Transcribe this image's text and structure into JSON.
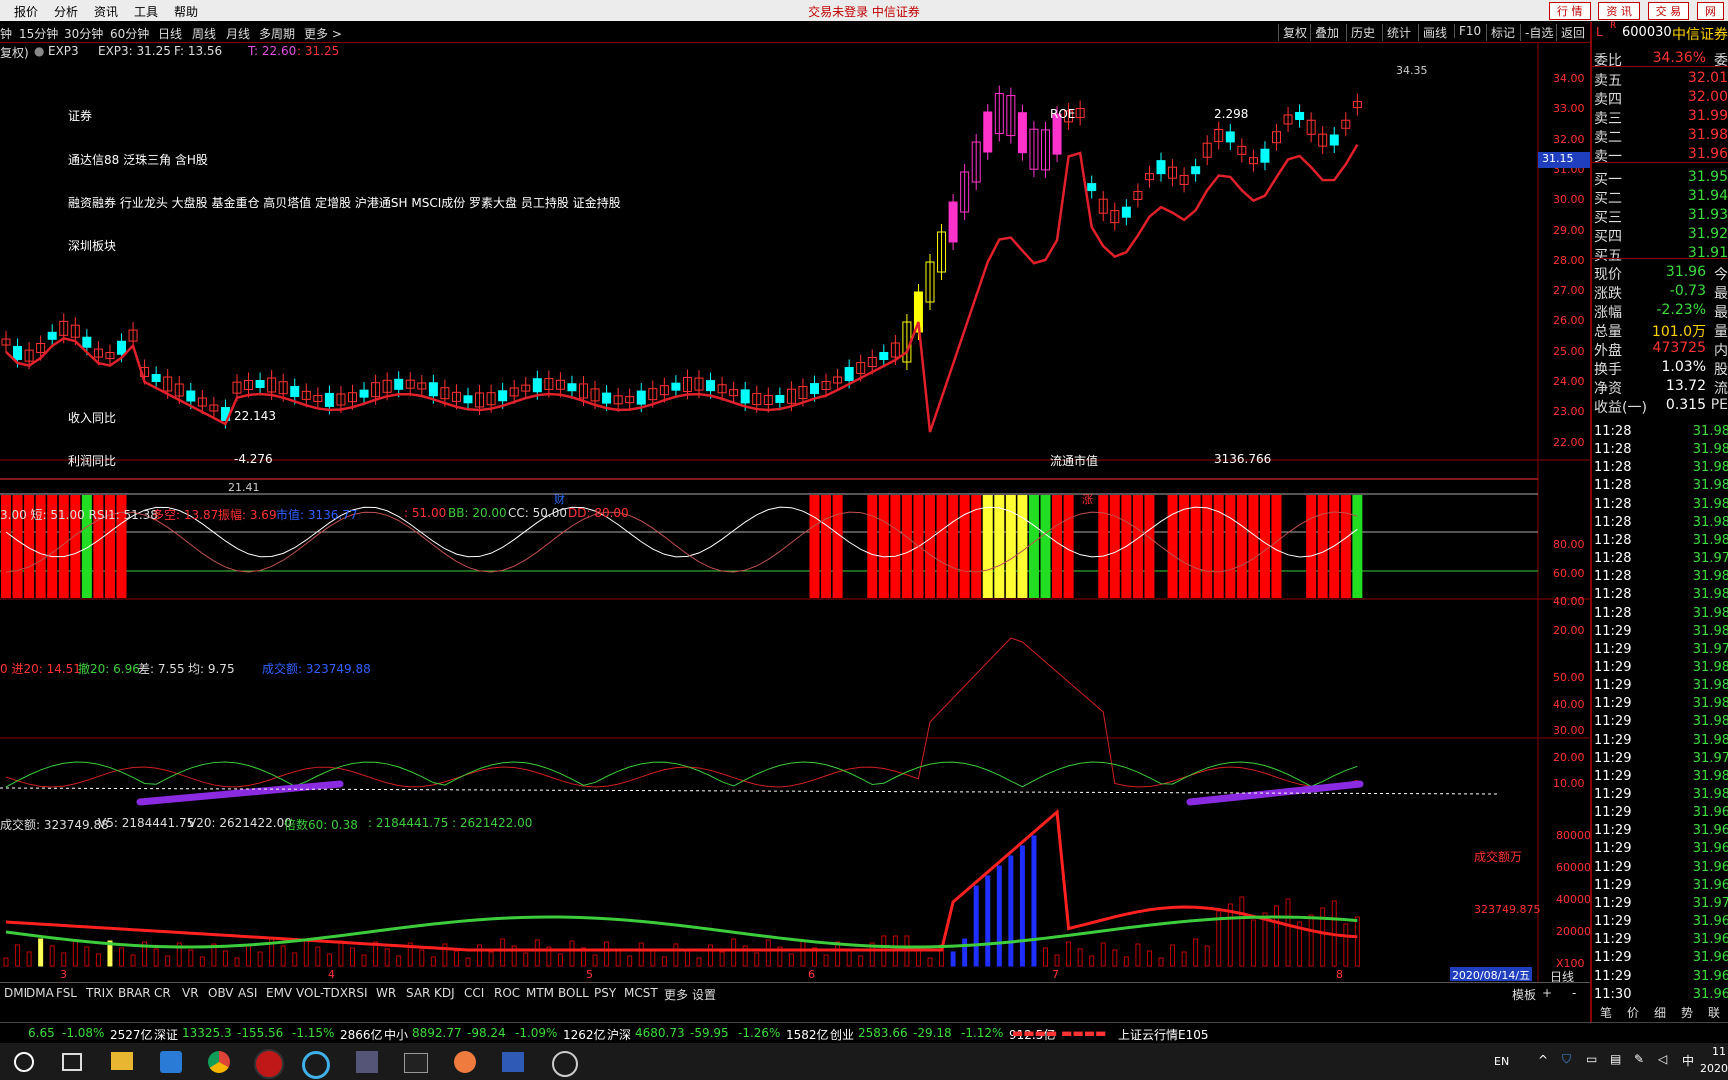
{
  "menu": {
    "items": [
      "报价",
      "分析",
      "资讯",
      "工具",
      "帮助"
    ],
    "brand": "交易未登录  中信证券",
    "right_buttons": [
      "行 情",
      "资 讯",
      "交 易",
      "网"
    ]
  },
  "toolbar": {
    "periods": [
      "钟",
      "15分钟",
      "30分钟",
      "60分钟",
      "日线",
      "周线",
      "月线",
      "多周期",
      "更多 >"
    ],
    "right": [
      "复权",
      "叠加",
      "历史",
      "统计",
      "画线",
      "F10",
      "标记",
      "-自选",
      "返回"
    ]
  },
  "chart_header": {
    "left": "复权)",
    "indicator": "EXP3",
    "exp3": "EXP3: 31.25",
    "f": "F: 13.56",
    "t": "T: 22.60",
    "t2": ": 31.25"
  },
  "stock": {
    "code": "600030",
    "name": "中信证券",
    "flag": "L",
    "r": "R",
    "price_tag": "31.15"
  },
  "overlay": {
    "sector": "证券",
    "concept1": "通达信88 泛珠三角 含H股",
    "concept2": "融资融券 行业龙头 大盘股 基金重仓 高贝塔值 定增股 沪港通SH MSCI成份 罗素大盘 员工持股 证金持股",
    "region": "深圳板块",
    "rev_label": "收入同比",
    "rev_value": "22.143",
    "profit_label": "利润同比",
    "profit_value": "-4.276",
    "roe_label": "ROE",
    "roe_value": "2.298",
    "mcap_label": "流通市值",
    "mcap_value": "3136.766",
    "high_mark": "34.35",
    "low_mark": "21.41",
    "cai": "财",
    "zhang": "涨"
  },
  "price_axis": [
    "34.00",
    "33.00",
    "32.00",
    "31.00",
    "30.00",
    "29.00",
    "28.00",
    "27.00",
    "26.00",
    "25.00",
    "24.00",
    "23.00",
    "22.00"
  ],
  "ind1_header": [
    "3.00 短: 51.00 RSI1: 51.38",
    "多空: 13.87",
    "振幅: 3.69",
    "市值: 3136.77",
    ": 51.00",
    "BB: 20.00",
    "CC: 50.00",
    "DD: 80.00"
  ],
  "ind1_axis": [
    "80.00",
    "60.00",
    "40.00",
    "20.00"
  ],
  "ind2_header": [
    "0 进20: 14.51",
    "撤20: 6.96",
    "差: 7.55",
    "均: 9.75",
    "成交额: 323749.88"
  ],
  "ind2_axis": [
    "50.00",
    "40.00",
    "30.00",
    "20.00",
    "10.00"
  ],
  "ind3_header": [
    "成交额: 323749.88",
    "V5: 2184441.75",
    "V20: 2621422.00",
    "倍数60: 0.38",
    ": 2184441.75",
    ": 2621422.00"
  ],
  "ind3_axis": [
    "80000",
    "60000",
    "40000",
    "20000",
    "X100"
  ],
  "ind3_label": "成交额万",
  "ind3_last": "323749.875",
  "date_axis": [
    "3",
    "4",
    "5",
    "6",
    "7",
    "8"
  ],
  "current_date": "2020/08/14/五",
  "bottom_tabs": [
    "DMI",
    "DMA",
    "FSL",
    "TRIX",
    "BRAR",
    "CR",
    "VR",
    "OBV",
    "ASI",
    "EMV",
    "VOL-TDX",
    "RSI",
    "WR",
    "SAR",
    "KDJ",
    "CCI",
    "ROC",
    "MTM",
    "BOLL",
    "PSY",
    "MCST",
    "更多",
    "设置"
  ],
  "bottom_right": [
    "模板",
    "+",
    "-"
  ],
  "day_line": "日线",
  "quotes": {
    "weibi": {
      "label": "委比",
      "value": "34.36%",
      "extra": "委"
    },
    "asks": [
      {
        "label": "卖五",
        "value": "32.01"
      },
      {
        "label": "卖四",
        "value": "32.00"
      },
      {
        "label": "卖三",
        "value": "31.99"
      },
      {
        "label": "卖二",
        "value": "31.98"
      },
      {
        "label": "卖一",
        "value": "31.96"
      }
    ],
    "bids": [
      {
        "label": "买一",
        "value": "31.95"
      },
      {
        "label": "买二",
        "value": "31.94"
      },
      {
        "label": "买三",
        "value": "31.93"
      },
      {
        "label": "买四",
        "value": "31.92"
      },
      {
        "label": "买五",
        "value": "31.91"
      }
    ],
    "stats": [
      {
        "label": "现价",
        "value": "31.96",
        "extra": "今"
      },
      {
        "label": "涨跌",
        "value": "-0.73",
        "extra": "最"
      },
      {
        "label": "涨幅",
        "value": "-2.23%",
        "extra": "最"
      },
      {
        "label": "总量",
        "value": "101.0万",
        "extra": "量"
      },
      {
        "label": "外盘",
        "value": "473725",
        "extra": "内"
      },
      {
        "label": "换手",
        "value": "1.03%",
        "extra": "股"
      },
      {
        "label": "净资",
        "value": "13.72",
        "extra": "流"
      },
      {
        "label": "收益(一)",
        "value": "0.315",
        "extra": "PE"
      }
    ]
  },
  "ticks": [
    [
      "11:28",
      "31.98"
    ],
    [
      "11:28",
      "31.98"
    ],
    [
      "11:28",
      "31.98"
    ],
    [
      "11:28",
      "31.98"
    ],
    [
      "11:28",
      "31.98"
    ],
    [
      "11:28",
      "31.98"
    ],
    [
      "11:28",
      "31.98"
    ],
    [
      "11:28",
      "31.97"
    ],
    [
      "11:28",
      "31.98"
    ],
    [
      "11:28",
      "31.98"
    ],
    [
      "11:28",
      "31.98"
    ],
    [
      "11:29",
      "31.98"
    ],
    [
      "11:29",
      "31.97"
    ],
    [
      "11:29",
      "31.98"
    ],
    [
      "11:29",
      "31.98"
    ],
    [
      "11:29",
      "31.98"
    ],
    [
      "11:29",
      "31.98"
    ],
    [
      "11:29",
      "31.98"
    ],
    [
      "11:29",
      "31.97"
    ],
    [
      "11:29",
      "31.98"
    ],
    [
      "11:29",
      "31.98"
    ],
    [
      "11:29",
      "31.96"
    ],
    [
      "11:29",
      "31.96"
    ],
    [
      "11:29",
      "31.96"
    ],
    [
      "11:29",
      "31.96"
    ],
    [
      "11:29",
      "31.96"
    ],
    [
      "11:29",
      "31.97"
    ],
    [
      "11:29",
      "31.96"
    ],
    [
      "11:29",
      "31.96"
    ],
    [
      "11:29",
      "31.96"
    ],
    [
      "11:29",
      "31.96"
    ],
    [
      "11:30",
      "31.96"
    ]
  ],
  "side_tabs": [
    "笔",
    "价",
    "细",
    "势",
    "联"
  ],
  "index_bar": [
    {
      "name": "",
      "value": "6.65",
      "chg": "-1.08%",
      "amt": "2527亿"
    },
    {
      "name": "深证",
      "value": "13325.3",
      "chg": "-155.56",
      "pct": "-1.15%",
      "amt": "2866亿"
    },
    {
      "name": "中小",
      "value": "8892.77",
      "chg": "-98.24",
      "pct": "-1.09%",
      "amt": "1262亿"
    },
    {
      "name": "沪深",
      "value": "4680.73",
      "chg": "-59.95",
      "pct": "-1.26%",
      "amt": "1582亿"
    },
    {
      "name": "创业",
      "value": "2583.66",
      "chg": "-29.18",
      "pct": "-1.12%",
      "amt": "912.5亿"
    }
  ],
  "index_cloud": "上证云行情E105",
  "tray": {
    "lang": "EN",
    "time": "11",
    "date": "2020"
  },
  "colors": {
    "up": "#ff3333",
    "down": "#00ffff",
    "ma_up": "#e0202a",
    "ma_down": "#3ccc3c",
    "grid": "#8b0000"
  }
}
